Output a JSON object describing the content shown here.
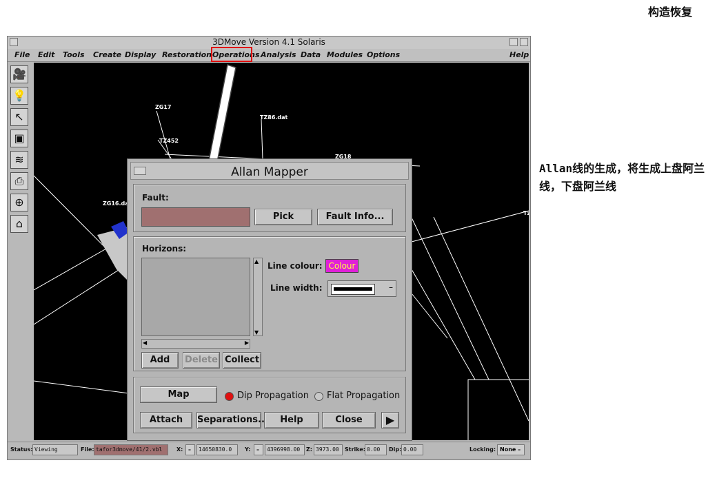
{
  "corner_title": "构造恢复",
  "caption": "Allan线的生成，将生成上盘阿兰线，下盘阿兰线",
  "window": {
    "title": "3DMove Version 4.1 Solaris",
    "menus": [
      "File",
      "Edit",
      "Tools",
      "Create",
      "Display",
      "Restoration",
      "Operations",
      "Analysis",
      "Data",
      "Modules",
      "Options",
      "Help"
    ],
    "highlighted_menu": "Operations"
  },
  "toolbar": {
    "tools": [
      "camera-icon",
      "lightbulb-icon",
      "pointer-arrow-icon",
      "box-icon",
      "layers-icon",
      "printer-icon",
      "crosshair-icon",
      "home-icon"
    ]
  },
  "canvas": {
    "labels": [
      "ZG17",
      "TZ86.dat",
      "TZ452",
      "ZG18",
      "ZG16.dat",
      "Tz"
    ]
  },
  "status": {
    "status_label": "Status:",
    "status_value": "Viewing",
    "file_label": "File:",
    "file_value": "tafor3dmove/41/2.vbl",
    "x_label": "X:",
    "x_value": "14650830.0",
    "y_label": "Y:",
    "y_value": "4396998.00",
    "z_label": "Z:",
    "z_value": "3973.00",
    "strike_label": "Strike:",
    "strike_value": "0.00",
    "dip_label": "Dip:",
    "dip_value": "0.00",
    "locking_label": "Locking:",
    "locking_value": "None"
  },
  "dialog": {
    "title": "Allan Mapper",
    "fault_label": "Fault:",
    "fault_value": "",
    "pick_label": "Pick",
    "fault_info_label": "Fault Info...",
    "horizons_label": "Horizons:",
    "line_colour_label": "Line colour:",
    "colour_button_label": "Colour",
    "colour_value": "#e020d8",
    "line_width_label": "Line width:",
    "add_label": "Add",
    "delete_label": "Delete",
    "collect_label": "Collect",
    "map_label": "Map",
    "dip_propagation_label": "Dip Propagation",
    "flat_propagation_label": "Flat Propagation",
    "selected_propagation": "Dip Propagation",
    "attach_label": "Attach",
    "separations_label": "Separations...",
    "help_label": "Help",
    "close_label": "Close"
  },
  "colors": {
    "highlight_box": "#e01010",
    "fault_field": "#a07070",
    "radio_selected": "#e01010"
  }
}
